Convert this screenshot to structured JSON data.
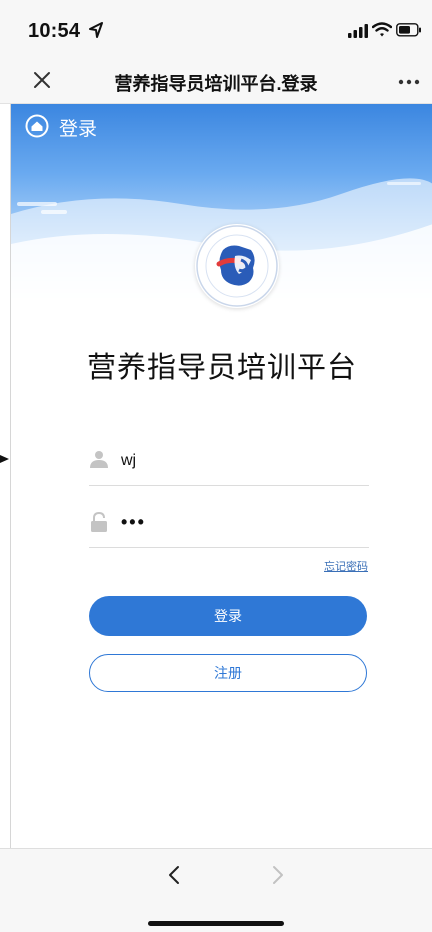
{
  "status_bar": {
    "time": "10:54"
  },
  "nav": {
    "title": "营养指导员培训平台.登录"
  },
  "header": {
    "title": "登录"
  },
  "platform": {
    "title": "营养指导员培训平台"
  },
  "form": {
    "username_value": "wj",
    "password_value": "•••",
    "forgot_label": "忘记密码",
    "login_label": "登录",
    "register_label": "注册"
  },
  "colors": {
    "accent": "#2f78d6",
    "header_blue": "#3b86e0",
    "link": "#3a6fb7"
  },
  "icons": {
    "location": "location-arrow-icon",
    "signal": "signal-icon",
    "wifi": "wifi-icon",
    "battery": "battery-icon",
    "close": "close-icon",
    "more": "more-icon",
    "home": "home-icon",
    "user": "user-icon",
    "lock": "lock-icon",
    "back": "chevron-left-icon",
    "forward": "chevron-right-icon"
  }
}
